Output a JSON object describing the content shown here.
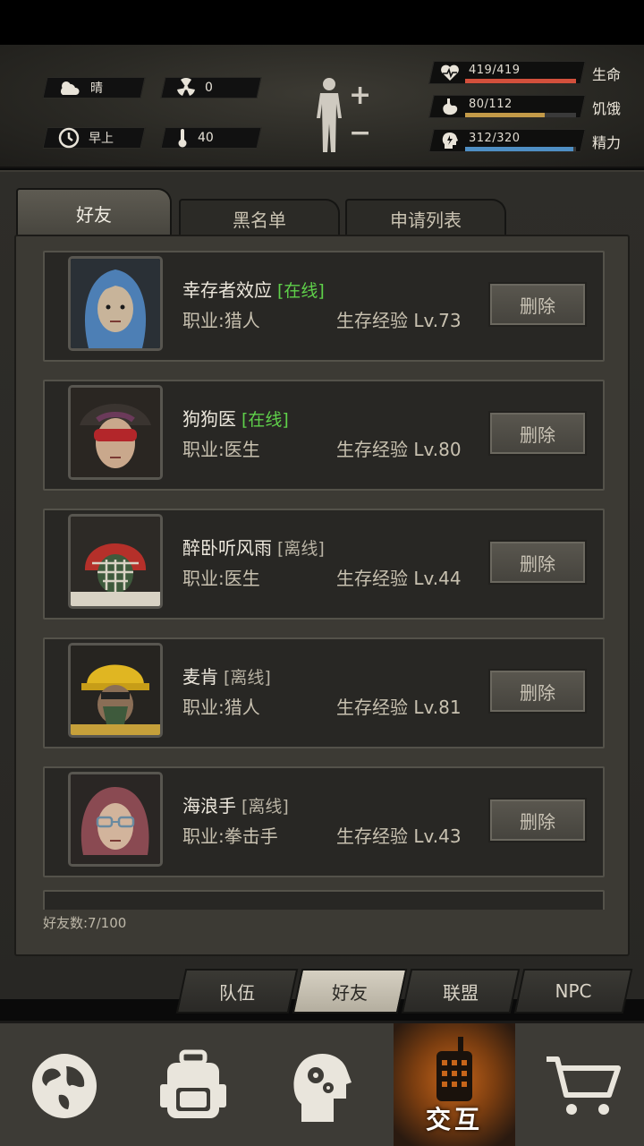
{
  "hud": {
    "weather": "晴",
    "radiation": "0",
    "time_of_day": "早上",
    "temperature": "40",
    "plus": "+",
    "minus": "−"
  },
  "stats": [
    {
      "value": "419/419",
      "name": "生命",
      "fraction": 1.0,
      "color": "#d2503c"
    },
    {
      "value": "80/112",
      "name": "饥饿",
      "fraction": 0.714,
      "color": "#c39a48"
    },
    {
      "value": "312/320",
      "name": "精力",
      "fraction": 0.975,
      "color": "#4f8fc4"
    }
  ],
  "tabs": {
    "friends": "好友",
    "blacklist": "黑名单",
    "requests": "申请列表"
  },
  "friends": [
    {
      "name": "幸存者效应",
      "status": "[在线]",
      "online": true,
      "job": "职业:猎人",
      "level": "生存经验 Lv.73",
      "delete": "删除",
      "avatar": "blue-hair"
    },
    {
      "name": "狗狗医",
      "status": "[在线]",
      "online": true,
      "job": "职业:医生",
      "level": "生存经验 Lv.80",
      "delete": "删除",
      "avatar": "goggles"
    },
    {
      "name": "醉卧听风雨",
      "status": "[离线]",
      "online": false,
      "job": "职业:医生",
      "level": "生存经验 Lv.44",
      "delete": "删除",
      "avatar": "helmet"
    },
    {
      "name": "麦肯",
      "status": "[离线]",
      "online": false,
      "job": "职业:猎人",
      "level": "生存经验 Lv.81",
      "delete": "删除",
      "avatar": "hardhat"
    },
    {
      "name": "海浪手",
      "status": "[离线]",
      "online": false,
      "job": "职业:拳击手",
      "level": "生存经验 Lv.43",
      "delete": "删除",
      "avatar": "glasses"
    }
  ],
  "friend_count": "好友数:7/100",
  "subtabs": {
    "team": "队伍",
    "friends": "好友",
    "alliance": "联盟",
    "npc": "NPC"
  },
  "nav": {
    "interact_label": "交互"
  },
  "colors": {
    "online": "#5fd04a",
    "offline": "#b9b3a4"
  }
}
